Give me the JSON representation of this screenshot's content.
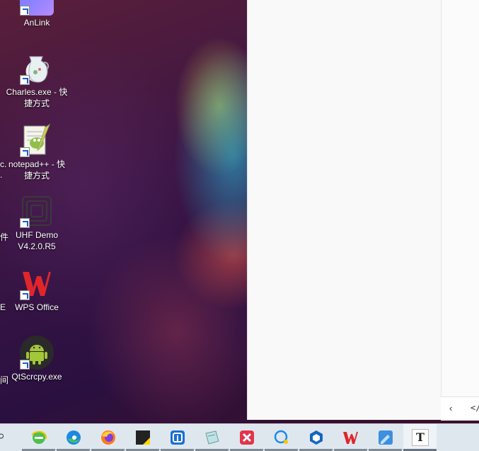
{
  "desktop": {
    "icons": [
      {
        "label": "AnLink",
        "icon": "anlink-icon"
      },
      {
        "label": "Charles.exe - 快捷方式",
        "icon": "charles-icon"
      },
      {
        "label": "notepad++ - 快捷方式",
        "icon": "notepadpp-icon"
      },
      {
        "label": "UHF Demo V4.2.0.R5",
        "icon": "uhf-demo-icon"
      },
      {
        "label": "WPS Office",
        "icon": "wps-icon"
      },
      {
        "label": "QtScrcpy.exe",
        "icon": "android-icon"
      }
    ],
    "edge_labels": [
      "c.",
      ".",
      "件",
      "E",
      "间"
    ]
  },
  "window": {
    "bottombar": {
      "back": "‹",
      "code": "</"
    }
  },
  "taskbar": {
    "search_glyph": "⌕",
    "apps": [
      {
        "name": "ie-icon"
      },
      {
        "name": "edge-icon"
      },
      {
        "name": "firefox-icon"
      },
      {
        "name": "sticky-notes-icon"
      },
      {
        "name": "app-store-icon"
      },
      {
        "name": "notes-icon"
      },
      {
        "name": "xmind-icon"
      },
      {
        "name": "chat-icon"
      },
      {
        "name": "cube-icon"
      },
      {
        "name": "wps-icon"
      },
      {
        "name": "drawing-icon"
      },
      {
        "name": "typora-icon",
        "text": "T"
      }
    ]
  },
  "colors": {
    "accent": "#1a5fd1",
    "wps_red": "#e0262b",
    "android_green": "#a4c639"
  }
}
